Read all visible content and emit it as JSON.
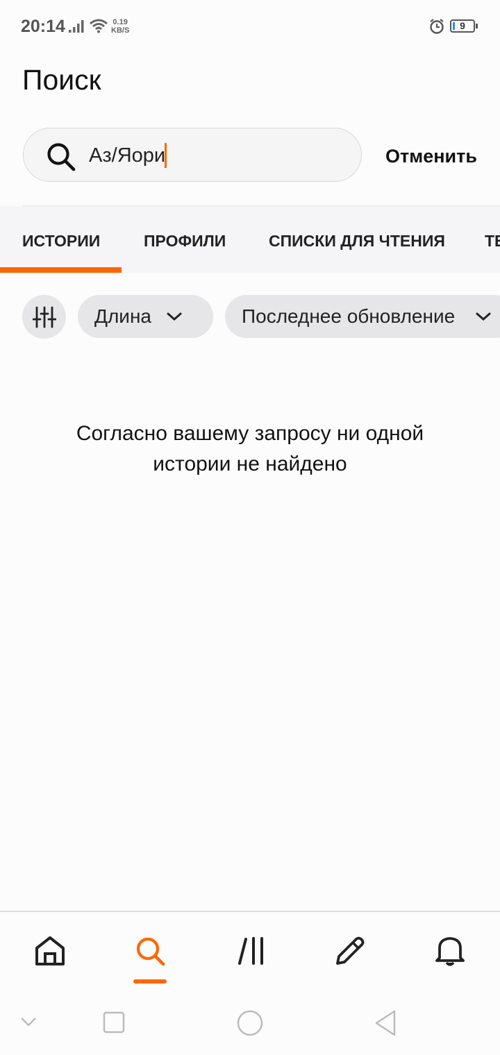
{
  "status_bar": {
    "time": "20:14",
    "speed_value": "0.19",
    "speed_unit": "KB/S",
    "battery": "9"
  },
  "header": {
    "title": "Поиск"
  },
  "search": {
    "value": "Аз/Яори",
    "cancel_label": "Отменить"
  },
  "tabs": [
    {
      "label": "ИСТОРИИ",
      "active": true
    },
    {
      "label": "ПРОФИЛИ",
      "active": false
    },
    {
      "label": "СПИСКИ ДЛЯ ЧТЕНИЯ",
      "active": false
    },
    {
      "label": "ТЕ",
      "active": false
    }
  ],
  "filters": {
    "length_label": "Длина",
    "updated_label": "Последнее обновление"
  },
  "empty_state": {
    "line1": "Согласно вашему запросу ни одной",
    "line2": "истории не найдено"
  },
  "bottom_nav": {
    "items": [
      "home-icon",
      "search-icon",
      "library-icon",
      "write-icon",
      "bell-icon"
    ],
    "active": "search-icon"
  },
  "colors": {
    "accent": "#ff6600",
    "text": "#121212",
    "chip_bg": "#e6e5e7"
  }
}
